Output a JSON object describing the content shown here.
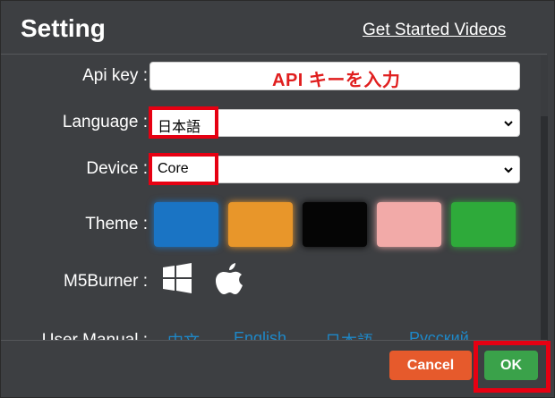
{
  "header": {
    "title": "Setting",
    "videos_link": "Get Started Videos"
  },
  "form": {
    "api_key": {
      "label": "Api key :",
      "annotation": "API キーを入力"
    },
    "language": {
      "label": "Language :",
      "value": "日本語"
    },
    "device": {
      "label": "Device :",
      "value": "Core"
    },
    "theme": {
      "label": "Theme :",
      "swatches": [
        "#1a74c4",
        "#e8962a",
        "#050505",
        "#f2aaa8",
        "#2eaa3a"
      ]
    },
    "burner": {
      "label": "M5Burner :",
      "icons": [
        "windows-icon",
        "apple-icon"
      ]
    },
    "manual": {
      "label": "User Manual :",
      "links": [
        "中文",
        "English",
        "日本語",
        "Русский"
      ]
    }
  },
  "footer": {
    "cancel_label": "Cancel",
    "ok_label": "OK"
  },
  "colors": {
    "dialog_bg": "#3d3f42",
    "highlight": "#e60012",
    "cancel": "#e65a2c",
    "ok": "#3aa24a",
    "link": "#1e88c8"
  }
}
